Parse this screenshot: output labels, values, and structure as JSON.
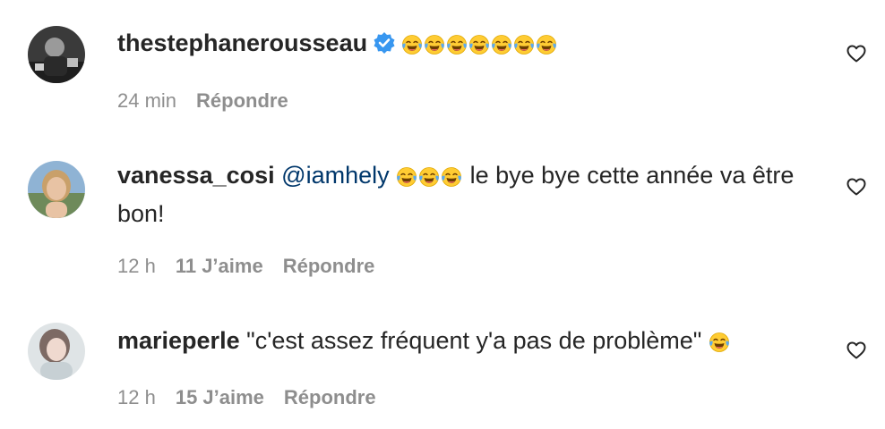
{
  "comments": [
    {
      "username": "thestephanerousseau",
      "verified": true,
      "mention": "",
      "emoji_count": 7,
      "text": "",
      "time": "24 min",
      "likes": "",
      "reply_label": "Répondre"
    },
    {
      "username": "vanessa_cosi",
      "verified": false,
      "mention": "@iamhely",
      "emoji_count": 3,
      "text": " le bye bye cette année va être bon!",
      "time": "12 h",
      "likes": "11 J’aime",
      "reply_label": "Répondre"
    },
    {
      "username": "marieperle",
      "verified": false,
      "mention": "",
      "emoji_count": 1,
      "text_before": "\"c'est assez fréquent y'a pas de problème\"",
      "time": "12 h",
      "likes": "15 J’aime",
      "reply_label": "Répondre"
    }
  ],
  "icons": {
    "like": "heart-outline-icon",
    "verified": "verified-badge-icon",
    "emoji": "face-with-tears-of-joy-emoji"
  },
  "colors": {
    "text": "#262626",
    "meta": "#8e8e8e",
    "mention": "#00376b",
    "verified": "#3897f0"
  }
}
